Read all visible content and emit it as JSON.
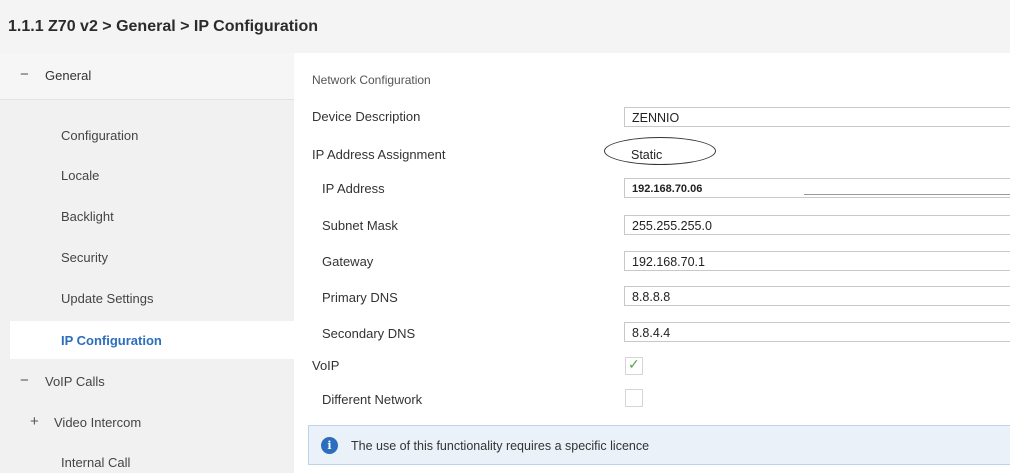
{
  "header": {
    "title": "1.1.1 Z70 v2 > General > IP Configuration"
  },
  "sidebar": {
    "section": {
      "sign": "−",
      "label": "General"
    },
    "items": [
      {
        "label": "Configuration"
      },
      {
        "label": "Locale"
      },
      {
        "label": "Backlight"
      },
      {
        "label": "Security"
      },
      {
        "label": "Update Settings"
      },
      {
        "label": "IP Configuration",
        "active": true
      }
    ],
    "voip": {
      "sign": "−",
      "label": "VoIP Calls"
    },
    "video": {
      "sign": "+",
      "label": "Video Intercom"
    },
    "internal": {
      "label": "Internal Call"
    }
  },
  "main": {
    "section_title": "Network Configuration",
    "device_description": {
      "label": "Device Description",
      "value": "ZENNIO"
    },
    "ip_assignment": {
      "label": "IP Address Assignment",
      "value": "Static"
    },
    "ip_address": {
      "label": "IP Address",
      "value": "192.168.70.06"
    },
    "subnet_mask": {
      "label": "Subnet Mask",
      "value": "255.255.255.0"
    },
    "gateway": {
      "label": "Gateway",
      "value": "192.168.70.1"
    },
    "primary_dns": {
      "label": "Primary DNS",
      "value": "8.8.8.8"
    },
    "secondary_dns": {
      "label": "Secondary DNS",
      "value": "8.8.4.4"
    },
    "voip": {
      "label": "VoIP",
      "checked": true,
      "tick": "✓"
    },
    "different_network": {
      "label": "Different Network",
      "checked": false
    },
    "info": {
      "icon": "i",
      "text": "The use of this functionality requires a specific licence"
    }
  },
  "colors": {
    "accent": "#2a6ebd",
    "check": "#5aa64a",
    "info_bg": "#eaf1f8"
  }
}
